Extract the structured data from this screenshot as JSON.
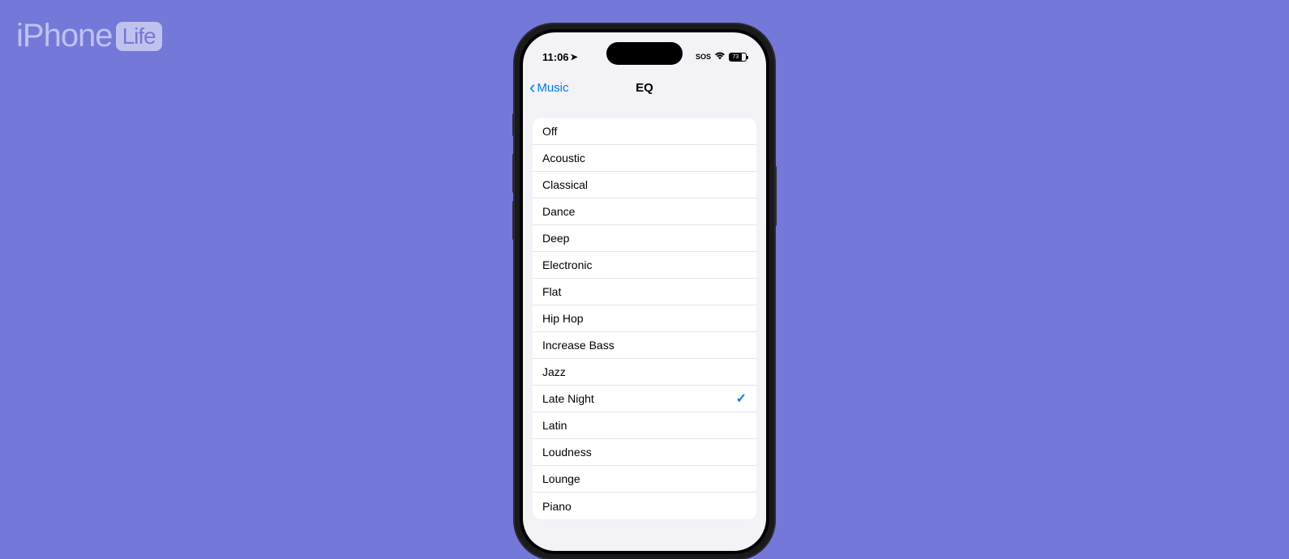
{
  "logo": {
    "brand": "iPhone",
    "suffix": "Life"
  },
  "status": {
    "time": "11:06",
    "sos": "SOS",
    "battery": "73"
  },
  "nav": {
    "back_label": "Music",
    "title": "EQ"
  },
  "eq_options": [
    {
      "label": "Off",
      "selected": false
    },
    {
      "label": "Acoustic",
      "selected": false
    },
    {
      "label": "Classical",
      "selected": false
    },
    {
      "label": "Dance",
      "selected": false
    },
    {
      "label": "Deep",
      "selected": false
    },
    {
      "label": "Electronic",
      "selected": false
    },
    {
      "label": "Flat",
      "selected": false
    },
    {
      "label": "Hip Hop",
      "selected": false
    },
    {
      "label": "Increase Bass",
      "selected": false
    },
    {
      "label": "Jazz",
      "selected": false
    },
    {
      "label": "Late Night",
      "selected": true
    },
    {
      "label": "Latin",
      "selected": false
    },
    {
      "label": "Loudness",
      "selected": false
    },
    {
      "label": "Lounge",
      "selected": false
    },
    {
      "label": "Piano",
      "selected": false
    }
  ]
}
